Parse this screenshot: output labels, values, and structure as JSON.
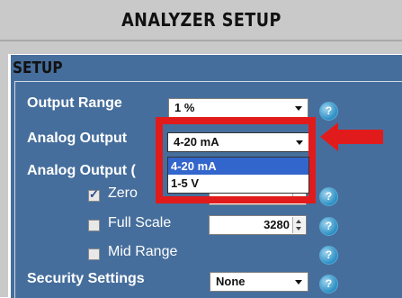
{
  "header": {
    "title": "ANALYZER SETUP"
  },
  "section": {
    "title": "SETUP"
  },
  "rows": {
    "output_range": {
      "label": "Output Range",
      "value": "1 %"
    },
    "analog_output": {
      "label": "Analog Output",
      "value": "4-20 mA"
    },
    "analog_output_cal": {
      "label": "Analog Output ("
    },
    "zero": {
      "label": "Zero",
      "value": "",
      "checked": true
    },
    "full_scale": {
      "label": "Full Scale",
      "value": "3280",
      "checked": false
    },
    "mid_range": {
      "label": "Mid Range",
      "checked": false
    },
    "security": {
      "label": "Security Settings",
      "value": "None"
    }
  },
  "dropdown": {
    "options": [
      "4-20 mA",
      "1-5 V"
    ],
    "selected": "4-20 mA"
  },
  "help_icon_text": "?",
  "colors": {
    "panel": "#466e9c",
    "header_bg": "#c9c9c9",
    "highlight": "#e11b1b",
    "selection": "#3366cc"
  }
}
